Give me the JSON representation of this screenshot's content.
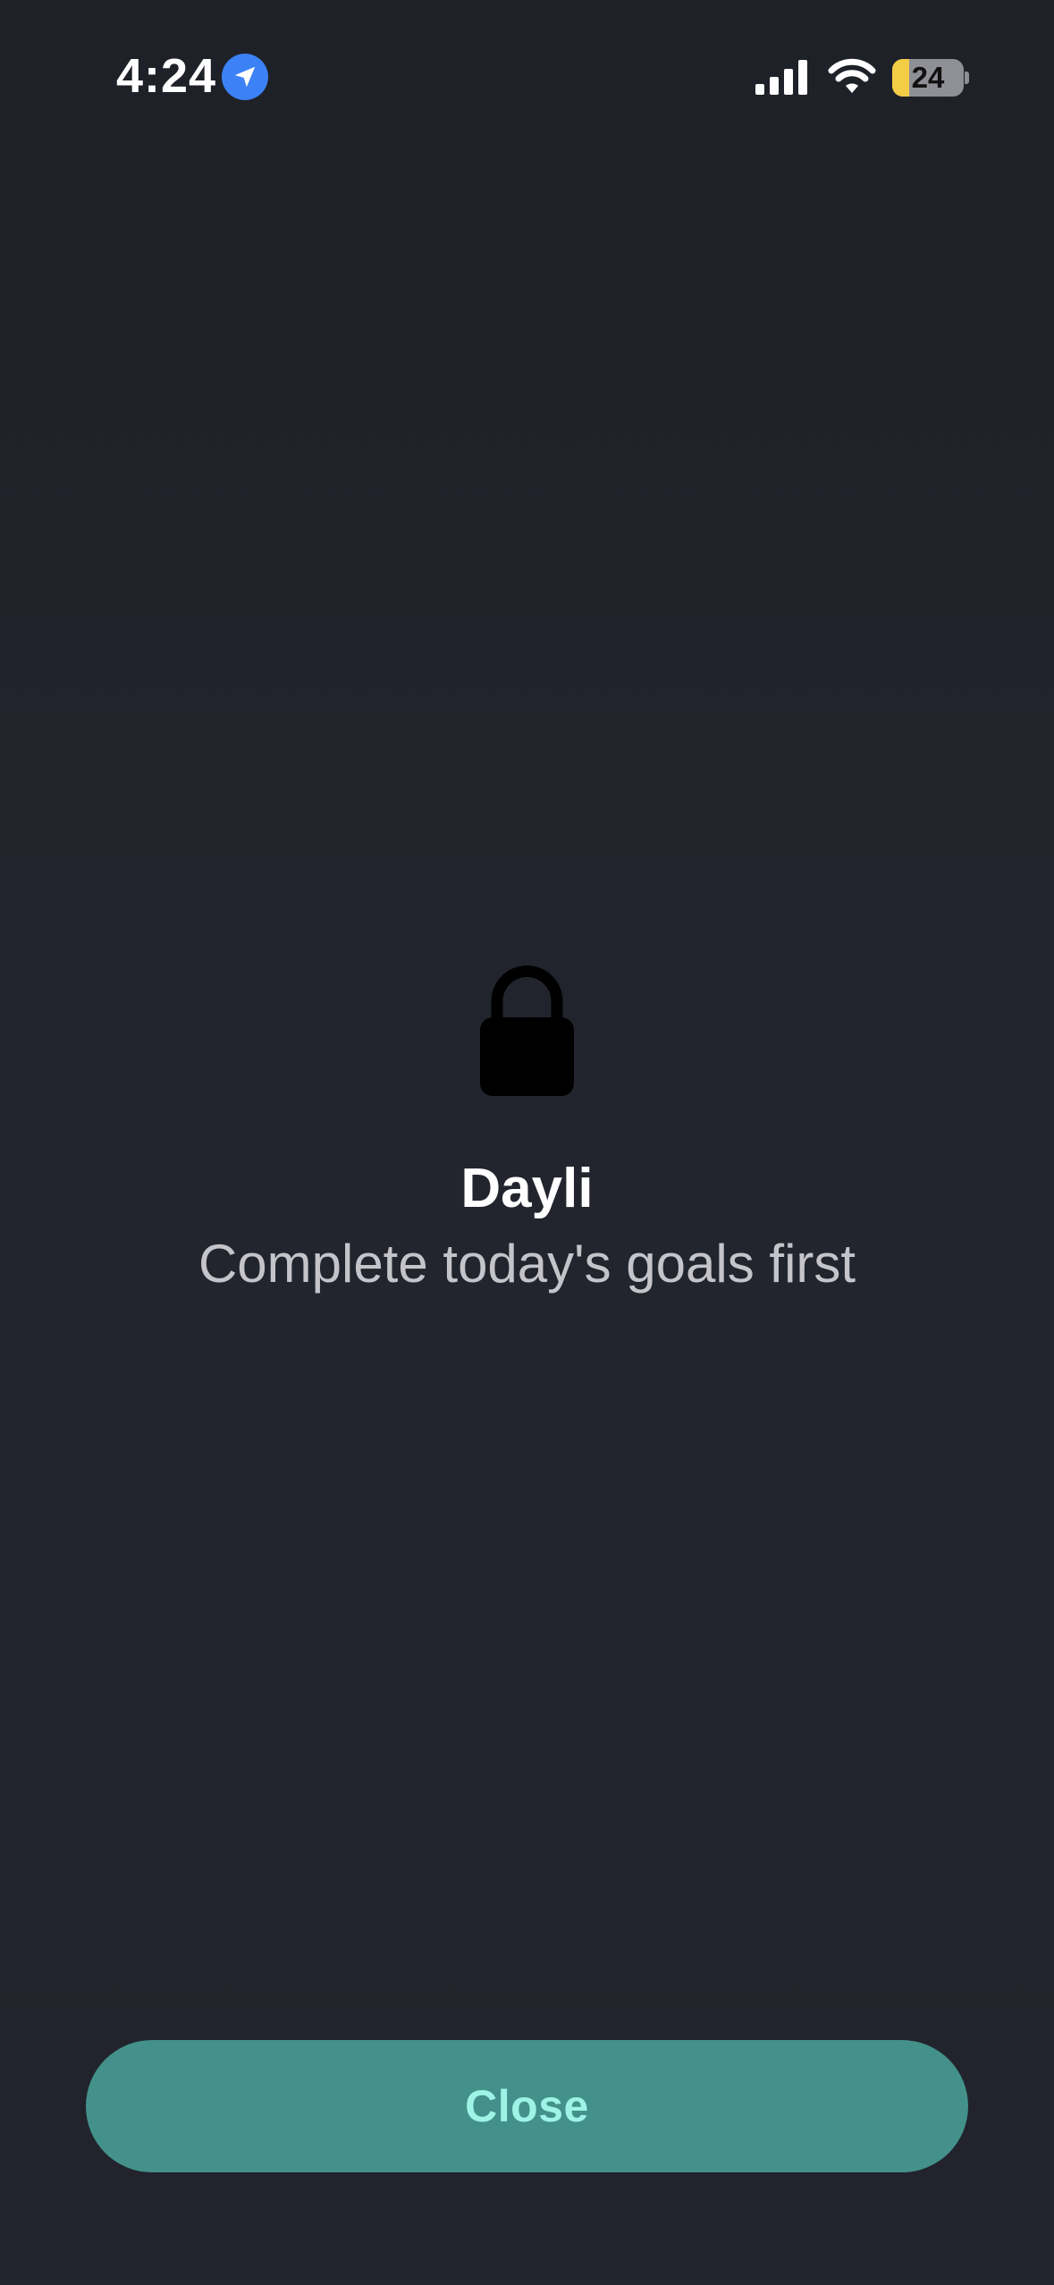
{
  "status_bar": {
    "time": "4:24",
    "battery_level": "24",
    "battery_fraction": 0.24,
    "icons": [
      "location-arrow-icon",
      "cellular-signal-icon",
      "wifi-icon",
      "battery-icon"
    ]
  },
  "lock_screen": {
    "icon": "lock-icon",
    "title": "Dayli",
    "subtitle": "Complete today's goals first"
  },
  "actions": {
    "close_label": "Close"
  },
  "colors": {
    "background": "#21232b",
    "button": "#43918a",
    "button_text": "#9ef3e6",
    "location_badge": "#3c82f6",
    "battery_fill": "#f4cd46"
  }
}
